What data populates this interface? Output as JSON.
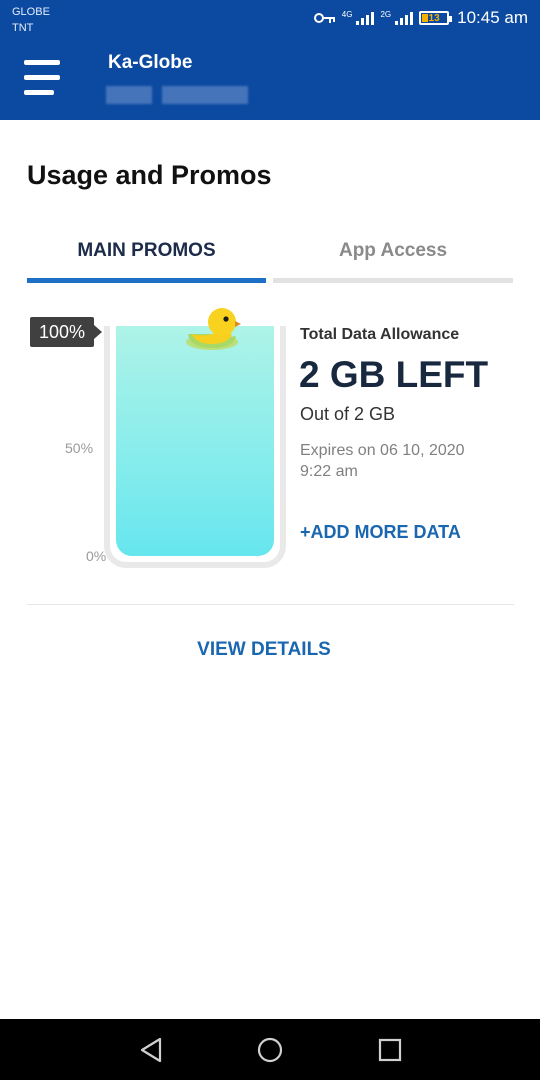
{
  "status_bar": {
    "carrier_1": "GLOBE",
    "carrier_2": "TNT",
    "net_1": "4G",
    "net_2": "2G",
    "battery": "13",
    "time": "10:45 am"
  },
  "header": {
    "title": "Ka-Globe",
    "bg_color": "#0b4aa0"
  },
  "page": {
    "title": "Usage and Promos"
  },
  "tabs": [
    {
      "label": "MAIN PROMOS",
      "active": true
    },
    {
      "label": "App Access",
      "active": false
    }
  ],
  "gauge": {
    "level_label": "100%",
    "mid_label": "50%",
    "min_label": "0%",
    "fill_fraction": 1.0
  },
  "data": {
    "allowance_label": "Total Data Allowance",
    "remaining": "2 GB LEFT",
    "total": "Out of 2 GB",
    "expires": "Expires on 06 10, 2020 9:22 am",
    "add_more": "+ADD MORE DATA"
  },
  "actions": {
    "view_details": "VIEW DETAILS"
  },
  "colors": {
    "accent": "#1a67b0",
    "tab_indicator": "#1e6fc6"
  }
}
